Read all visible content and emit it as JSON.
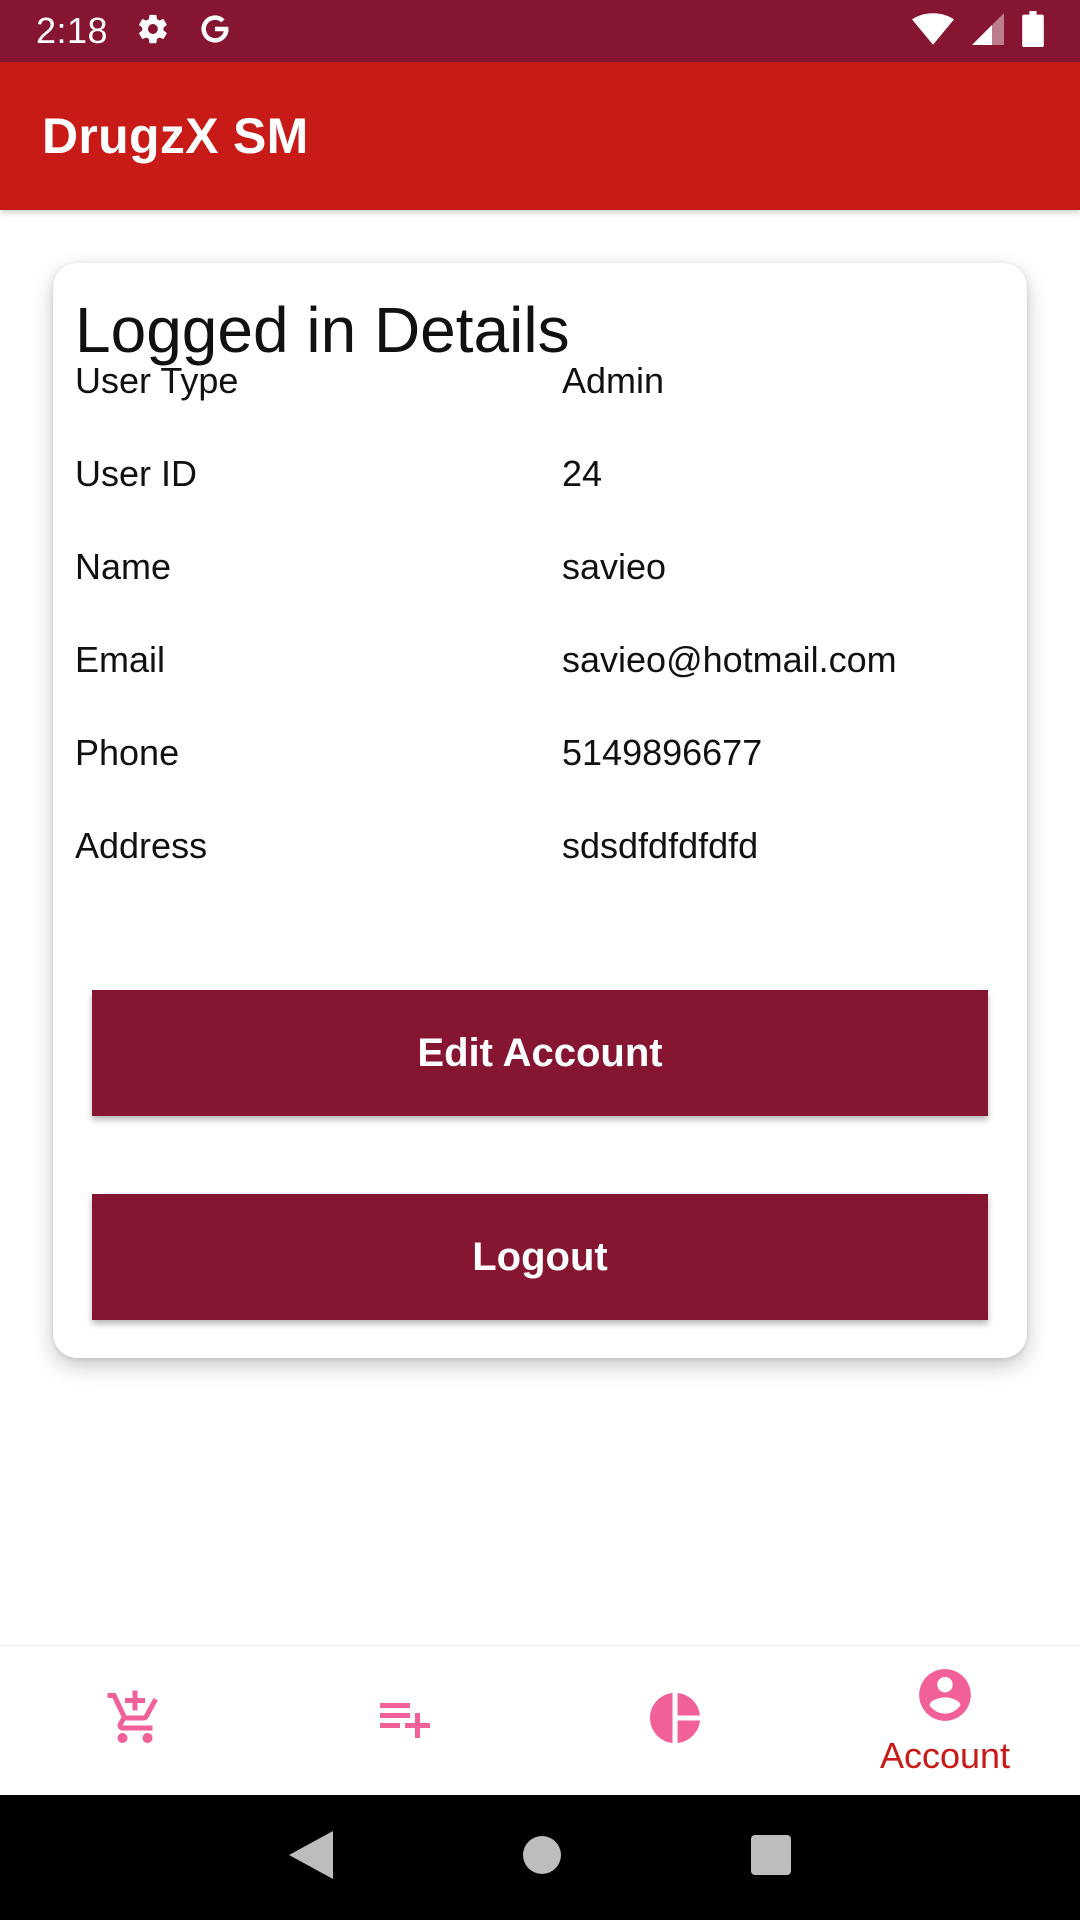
{
  "status_bar": {
    "time": "2:18",
    "icons": [
      "gear-icon",
      "google-icon",
      "wifi-icon",
      "signal-icon",
      "battery-icon"
    ]
  },
  "app_bar": {
    "title": "DrugzX SM"
  },
  "card": {
    "title": "Logged in Details",
    "rows": [
      {
        "label": "User Type",
        "value": "Admin"
      },
      {
        "label": "User ID",
        "value": "24"
      },
      {
        "label": "Name",
        "value": "savieo"
      },
      {
        "label": "Email",
        "value": "savieo@hotmail.com"
      },
      {
        "label": "Phone",
        "value": "5149896677"
      },
      {
        "label": "Address",
        "value": "sdsdfdfdfdfd"
      }
    ],
    "edit_label": "Edit Account",
    "logout_label": "Logout"
  },
  "bottom_nav": {
    "items": [
      {
        "icon": "add-to-cart-icon",
        "label": ""
      },
      {
        "icon": "playlist-add-icon",
        "label": ""
      },
      {
        "icon": "pie-chart-icon",
        "label": ""
      },
      {
        "icon": "account-circle-icon",
        "label": "Account"
      }
    ],
    "active_color": "#c81a16",
    "inactive_color": "#f2609a"
  },
  "colors": {
    "status_bar": "#851530",
    "app_bar": "#c81a16",
    "button": "#851530"
  }
}
